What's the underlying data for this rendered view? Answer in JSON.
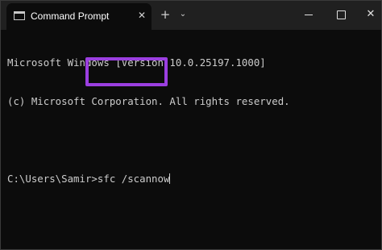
{
  "window": {
    "tab_title": "Command Prompt",
    "tab_icon": "terminal-icon",
    "tab_close_symbol": "✕",
    "new_tab_symbol": "+",
    "dropdown_symbol": "⌄",
    "close_symbol": "✕"
  },
  "console": {
    "lines": [
      "Microsoft Windows [Version 10.0.25197.1000]",
      "(c) Microsoft Corporation. All rights reserved."
    ],
    "prompt": "C:\\Users\\Samir>",
    "command": "sfc /scannow"
  },
  "colors": {
    "console_bg": "#0c0c0c",
    "titlebar_bg": "#202020",
    "text": "#cccccc",
    "highlight": "#9b3fe0"
  }
}
